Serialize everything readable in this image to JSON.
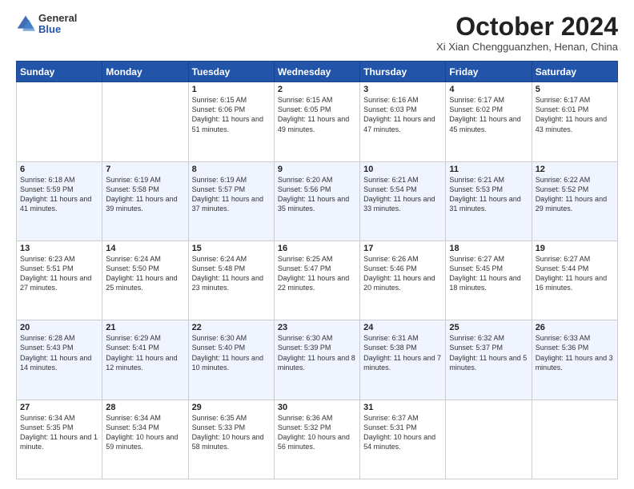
{
  "header": {
    "logo_general": "General",
    "logo_blue": "Blue",
    "month_title": "October 2024",
    "location": "Xi Xian Chengguanzhen, Henan, China"
  },
  "weekdays": [
    "Sunday",
    "Monday",
    "Tuesday",
    "Wednesday",
    "Thursday",
    "Friday",
    "Saturday"
  ],
  "weeks": [
    [
      {
        "day": "",
        "sunrise": "",
        "sunset": "",
        "daylight": ""
      },
      {
        "day": "",
        "sunrise": "",
        "sunset": "",
        "daylight": ""
      },
      {
        "day": "1",
        "sunrise": "Sunrise: 6:15 AM",
        "sunset": "Sunset: 6:06 PM",
        "daylight": "Daylight: 11 hours and 51 minutes."
      },
      {
        "day": "2",
        "sunrise": "Sunrise: 6:15 AM",
        "sunset": "Sunset: 6:05 PM",
        "daylight": "Daylight: 11 hours and 49 minutes."
      },
      {
        "day": "3",
        "sunrise": "Sunrise: 6:16 AM",
        "sunset": "Sunset: 6:03 PM",
        "daylight": "Daylight: 11 hours and 47 minutes."
      },
      {
        "day": "4",
        "sunrise": "Sunrise: 6:17 AM",
        "sunset": "Sunset: 6:02 PM",
        "daylight": "Daylight: 11 hours and 45 minutes."
      },
      {
        "day": "5",
        "sunrise": "Sunrise: 6:17 AM",
        "sunset": "Sunset: 6:01 PM",
        "daylight": "Daylight: 11 hours and 43 minutes."
      }
    ],
    [
      {
        "day": "6",
        "sunrise": "Sunrise: 6:18 AM",
        "sunset": "Sunset: 5:59 PM",
        "daylight": "Daylight: 11 hours and 41 minutes."
      },
      {
        "day": "7",
        "sunrise": "Sunrise: 6:19 AM",
        "sunset": "Sunset: 5:58 PM",
        "daylight": "Daylight: 11 hours and 39 minutes."
      },
      {
        "day": "8",
        "sunrise": "Sunrise: 6:19 AM",
        "sunset": "Sunset: 5:57 PM",
        "daylight": "Daylight: 11 hours and 37 minutes."
      },
      {
        "day": "9",
        "sunrise": "Sunrise: 6:20 AM",
        "sunset": "Sunset: 5:56 PM",
        "daylight": "Daylight: 11 hours and 35 minutes."
      },
      {
        "day": "10",
        "sunrise": "Sunrise: 6:21 AM",
        "sunset": "Sunset: 5:54 PM",
        "daylight": "Daylight: 11 hours and 33 minutes."
      },
      {
        "day": "11",
        "sunrise": "Sunrise: 6:21 AM",
        "sunset": "Sunset: 5:53 PM",
        "daylight": "Daylight: 11 hours and 31 minutes."
      },
      {
        "day": "12",
        "sunrise": "Sunrise: 6:22 AM",
        "sunset": "Sunset: 5:52 PM",
        "daylight": "Daylight: 11 hours and 29 minutes."
      }
    ],
    [
      {
        "day": "13",
        "sunrise": "Sunrise: 6:23 AM",
        "sunset": "Sunset: 5:51 PM",
        "daylight": "Daylight: 11 hours and 27 minutes."
      },
      {
        "day": "14",
        "sunrise": "Sunrise: 6:24 AM",
        "sunset": "Sunset: 5:50 PM",
        "daylight": "Daylight: 11 hours and 25 minutes."
      },
      {
        "day": "15",
        "sunrise": "Sunrise: 6:24 AM",
        "sunset": "Sunset: 5:48 PM",
        "daylight": "Daylight: 11 hours and 23 minutes."
      },
      {
        "day": "16",
        "sunrise": "Sunrise: 6:25 AM",
        "sunset": "Sunset: 5:47 PM",
        "daylight": "Daylight: 11 hours and 22 minutes."
      },
      {
        "day": "17",
        "sunrise": "Sunrise: 6:26 AM",
        "sunset": "Sunset: 5:46 PM",
        "daylight": "Daylight: 11 hours and 20 minutes."
      },
      {
        "day": "18",
        "sunrise": "Sunrise: 6:27 AM",
        "sunset": "Sunset: 5:45 PM",
        "daylight": "Daylight: 11 hours and 18 minutes."
      },
      {
        "day": "19",
        "sunrise": "Sunrise: 6:27 AM",
        "sunset": "Sunset: 5:44 PM",
        "daylight": "Daylight: 11 hours and 16 minutes."
      }
    ],
    [
      {
        "day": "20",
        "sunrise": "Sunrise: 6:28 AM",
        "sunset": "Sunset: 5:43 PM",
        "daylight": "Daylight: 11 hours and 14 minutes."
      },
      {
        "day": "21",
        "sunrise": "Sunrise: 6:29 AM",
        "sunset": "Sunset: 5:41 PM",
        "daylight": "Daylight: 11 hours and 12 minutes."
      },
      {
        "day": "22",
        "sunrise": "Sunrise: 6:30 AM",
        "sunset": "Sunset: 5:40 PM",
        "daylight": "Daylight: 11 hours and 10 minutes."
      },
      {
        "day": "23",
        "sunrise": "Sunrise: 6:30 AM",
        "sunset": "Sunset: 5:39 PM",
        "daylight": "Daylight: 11 hours and 8 minutes."
      },
      {
        "day": "24",
        "sunrise": "Sunrise: 6:31 AM",
        "sunset": "Sunset: 5:38 PM",
        "daylight": "Daylight: 11 hours and 7 minutes."
      },
      {
        "day": "25",
        "sunrise": "Sunrise: 6:32 AM",
        "sunset": "Sunset: 5:37 PM",
        "daylight": "Daylight: 11 hours and 5 minutes."
      },
      {
        "day": "26",
        "sunrise": "Sunrise: 6:33 AM",
        "sunset": "Sunset: 5:36 PM",
        "daylight": "Daylight: 11 hours and 3 minutes."
      }
    ],
    [
      {
        "day": "27",
        "sunrise": "Sunrise: 6:34 AM",
        "sunset": "Sunset: 5:35 PM",
        "daylight": "Daylight: 11 hours and 1 minute."
      },
      {
        "day": "28",
        "sunrise": "Sunrise: 6:34 AM",
        "sunset": "Sunset: 5:34 PM",
        "daylight": "Daylight: 10 hours and 59 minutes."
      },
      {
        "day": "29",
        "sunrise": "Sunrise: 6:35 AM",
        "sunset": "Sunset: 5:33 PM",
        "daylight": "Daylight: 10 hours and 58 minutes."
      },
      {
        "day": "30",
        "sunrise": "Sunrise: 6:36 AM",
        "sunset": "Sunset: 5:32 PM",
        "daylight": "Daylight: 10 hours and 56 minutes."
      },
      {
        "day": "31",
        "sunrise": "Sunrise: 6:37 AM",
        "sunset": "Sunset: 5:31 PM",
        "daylight": "Daylight: 10 hours and 54 minutes."
      },
      {
        "day": "",
        "sunrise": "",
        "sunset": "",
        "daylight": ""
      },
      {
        "day": "",
        "sunrise": "",
        "sunset": "",
        "daylight": ""
      }
    ]
  ]
}
